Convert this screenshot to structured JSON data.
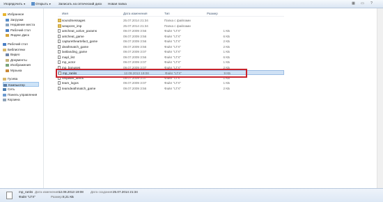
{
  "toolbar": {
    "organize": "Упорядочить",
    "open": "Открыть",
    "burn": "Записать на оптический диск",
    "new_folder": "Новая папка"
  },
  "nav": [
    {
      "label": "Избранное",
      "icon": "star-icon",
      "color": "#e8b530"
    },
    {
      "label": "Загрузки",
      "icon": "downloads-folder-icon",
      "color": "#5b8fc9"
    },
    {
      "label": "Недавние места",
      "icon": "recent-places-icon",
      "color": "#8aa4c0"
    },
    {
      "label": "Рабочий стол",
      "icon": "desktop-icon",
      "color": "#4b7fc4"
    },
    {
      "label": "Яндекс.Диск",
      "icon": "yandex-disk-icon",
      "color": "#d6a53a"
    },
    {
      "label": "Рабочий стол",
      "icon": "desktop-icon",
      "color": "#4b7fc4"
    },
    {
      "label": "Библиотеки",
      "icon": "libraries-icon",
      "color": "#d9b76a"
    },
    {
      "label": "Видео",
      "icon": "video-icon",
      "color": "#6f86a8"
    },
    {
      "label": "Документы",
      "icon": "documents-icon",
      "color": "#c9b27a"
    },
    {
      "label": "Изображения",
      "icon": "pictures-icon",
      "color": "#7ba67a"
    },
    {
      "label": "Музыка",
      "icon": "music-icon",
      "color": "#c98a3a"
    },
    {
      "label": "Гусева",
      "icon": "user-folder-icon",
      "color": "#d9b76a"
    },
    {
      "label": "Компьютер",
      "icon": "computer-icon",
      "color": "#5b7ea6"
    },
    {
      "label": "Сеть",
      "icon": "network-icon",
      "color": "#4c7fb0"
    },
    {
      "label": "Панель управления",
      "icon": "control-panel-icon",
      "color": "#6d9bd0"
    },
    {
      "label": "Корзина",
      "icon": "recycle-bin-icon",
      "color": "#8fa3b8"
    }
  ],
  "columns": {
    "name": "Имя",
    "date": "Дата изменения",
    "type": "Тип",
    "size": "Размер"
  },
  "files": [
    {
      "name": "soundmessages",
      "date": "25.07.2014 21:34",
      "type": "Папка с файлами",
      "size": "",
      "kind": "folder"
    },
    {
      "name": "weapons_imp",
      "date": "25.07.2014 21:34",
      "type": "Папка с файлами",
      "size": "",
      "kind": "folder"
    },
    {
      "name": "antcheat_active_params",
      "date": "09.07.2009 3:56",
      "type": "Файл \"LTX\"",
      "size": "1 КБ",
      "kind": "file"
    },
    {
      "name": "antcheat_game",
      "date": "09.07.2009 3:56",
      "type": "Файл \"LTX\"",
      "size": "6 КБ",
      "kind": "file"
    },
    {
      "name": "capturetheartefact_game",
      "date": "09.07.2009 3:56",
      "type": "Файл \"LTX\"",
      "size": "2 КБ",
      "kind": "file"
    },
    {
      "name": "deathmatch_game",
      "date": "09.07.2009 3:56",
      "type": "Файл \"LTX\"",
      "size": "2 КБ",
      "kind": "file"
    },
    {
      "name": "lastlanding_game",
      "date": "09.07.2009 3:07",
      "type": "Файл \"LTX\"",
      "size": "1 КБ",
      "kind": "file"
    },
    {
      "name": "mapl_list",
      "date": "09.07.2009 3:56",
      "type": "Файл \"LTX\"",
      "size": "6 КБ",
      "kind": "file"
    },
    {
      "name": "mp_actor",
      "date": "09.07.2009 3:07",
      "type": "Файл \"LTX\"",
      "size": "1 КБ",
      "kind": "file"
    },
    {
      "name": "mp_bonuses",
      "date": "09.07.2009 3:07",
      "type": "Файл \"LTX\"",
      "size": "2 КБ",
      "kind": "file"
    },
    {
      "name": "mp_ranks",
      "date": "12.08.2013 19:08",
      "type": "Файл \"LTX\"",
      "size": "9 КБ",
      "kind": "file",
      "selected": true
    },
    {
      "name": "respawn_items",
      "date": "09.07.2009 3:07",
      "type": "Файл \"LTX\"",
      "size": "1 КБ",
      "kind": "file"
    },
    {
      "name": "team_logos",
      "date": "09.07.2009 3:07",
      "type": "Файл \"LTX\"",
      "size": "1 КБ",
      "kind": "file"
    },
    {
      "name": "teamdeathmatch_game",
      "date": "09.07.2009 3:56",
      "type": "Файл \"LTX\"",
      "size": "2 КБ",
      "kind": "file"
    }
  ],
  "details": {
    "name": "mp_ranks",
    "modified_label": "Дата изменения:",
    "modified_value": "12.08.2013 19:08",
    "type_value": "Файл \"LTX\"",
    "size_label": "Размер:",
    "size_value": "8,21 КБ",
    "created_label": "Дата создания:",
    "created_value": "25.07.2014 21:34"
  },
  "colors": {
    "selection": "#cfe1f5",
    "highlight_box": "#c8232c",
    "folder": "#e6c25c"
  }
}
